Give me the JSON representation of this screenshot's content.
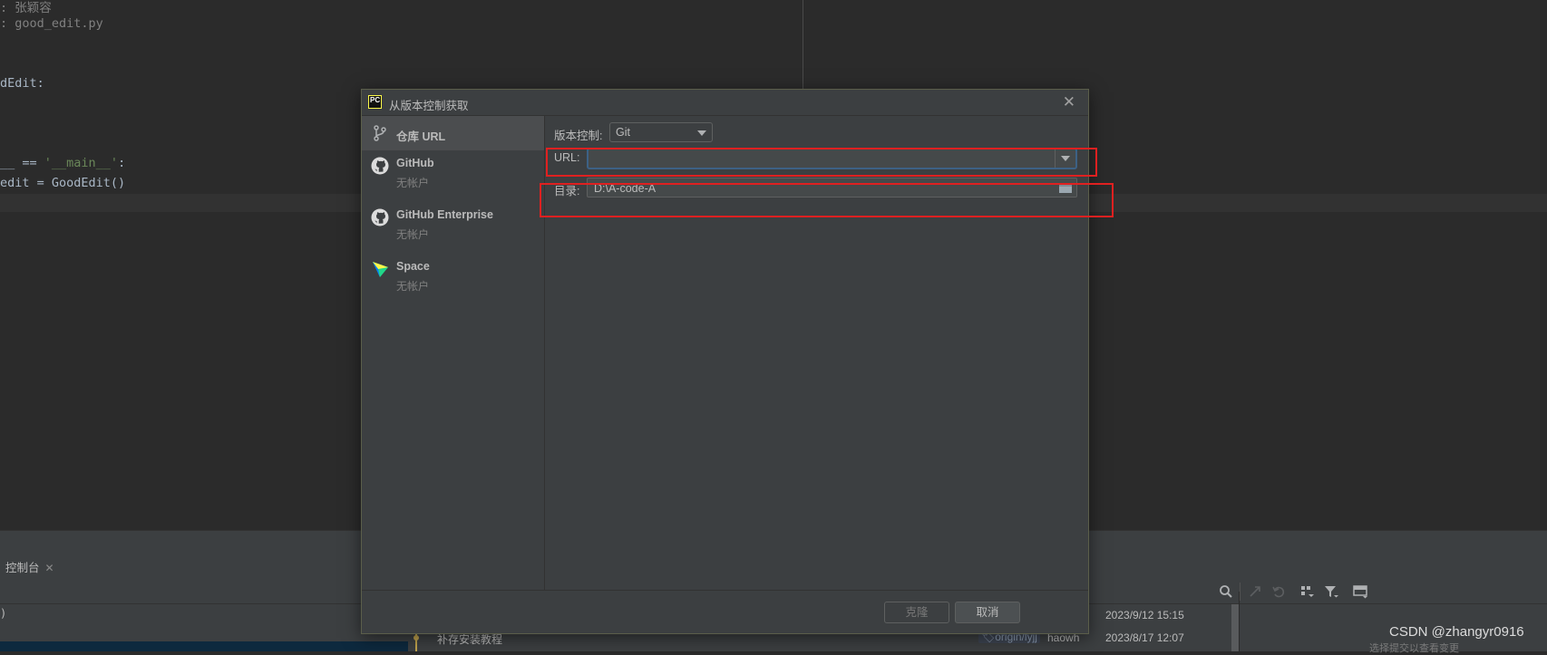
{
  "editor": {
    "lines": [
      {
        "text": ": 张颖容",
        "dim": true
      },
      {
        "text": ": good_edit.py",
        "dim": true
      },
      {
        "text": "dEdit:",
        "dim": false
      },
      {
        "text_pre": "__ == ",
        "text_str": "'__main__'",
        "text_post": ":"
      },
      {
        "text": "edit = GoodEdit()",
        "dim": false
      }
    ]
  },
  "dialog": {
    "title": "从版本控制获取",
    "logo_text": "PC",
    "sidebar": [
      {
        "label": "仓库 URL",
        "sub": ""
      },
      {
        "label": "GitHub",
        "sub": "无帐户"
      },
      {
        "label": "GitHub Enterprise",
        "sub": "无帐户"
      },
      {
        "label": "Space",
        "sub": "无帐户"
      }
    ],
    "vcs_label": "版本控制:",
    "vcs_value": "Git",
    "url_label": "URL:",
    "url_value": "",
    "dir_label": "目录:",
    "dir_value": "D:\\A-code-A",
    "clone_button": "克隆",
    "cancel_button": "取消"
  },
  "toolwindow": {
    "tab_label": "控制台",
    "left_text": ")",
    "log": [
      {
        "message": "",
        "branch": "",
        "author": "",
        "date": "2023/9/12 15:15"
      },
      {
        "message": "补存安装教程",
        "branch": "origin/lyjj",
        "author": "haowh",
        "date": "2023/8/17 12:07"
      }
    ]
  },
  "watermark": "CSDN @zhangyr0916",
  "watermark_sub": "选择提交以查看变更"
}
